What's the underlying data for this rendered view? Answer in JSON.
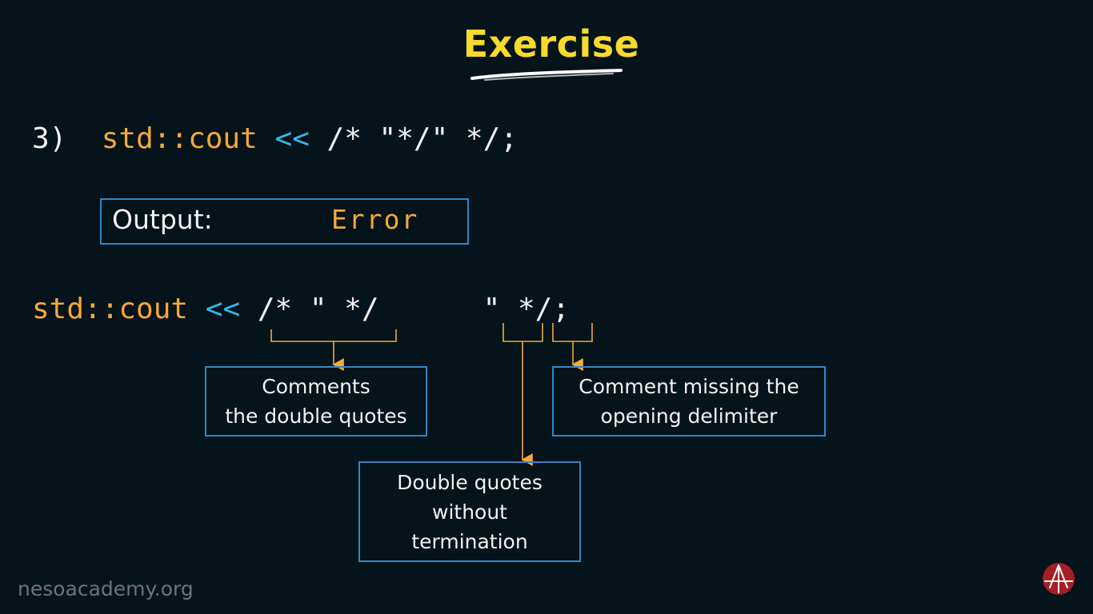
{
  "slide": {
    "title": "Exercise",
    "question": {
      "number": "3)",
      "code_std": "std::cout",
      "code_op": "<<",
      "code_rest": "/* \"*/\" */;"
    },
    "output": {
      "label": "Output:",
      "value": "Error"
    },
    "breakdown": {
      "code_std": "std::cout",
      "code_op": "<<",
      "part_comment": "/* \" */",
      "part_quote": "\"",
      "part_end": "*/;"
    },
    "notes": {
      "comments": [
        "Comments",
        "the double quotes"
      ],
      "missing": [
        "Comment missing the",
        "opening delimiter"
      ],
      "quotes": [
        "Double quotes",
        "without",
        "termination"
      ]
    }
  },
  "footer": {
    "site": "nesoacademy.org"
  },
  "colors": {
    "background": "#05131a",
    "title": "#f7da2c",
    "code_keyword": "#f5a93a",
    "code_operator": "#34b8e8",
    "box_border": "#2f86c9",
    "connector": "#f5a93a"
  },
  "icons": {
    "logo": "neso-academy-logo-icon"
  }
}
